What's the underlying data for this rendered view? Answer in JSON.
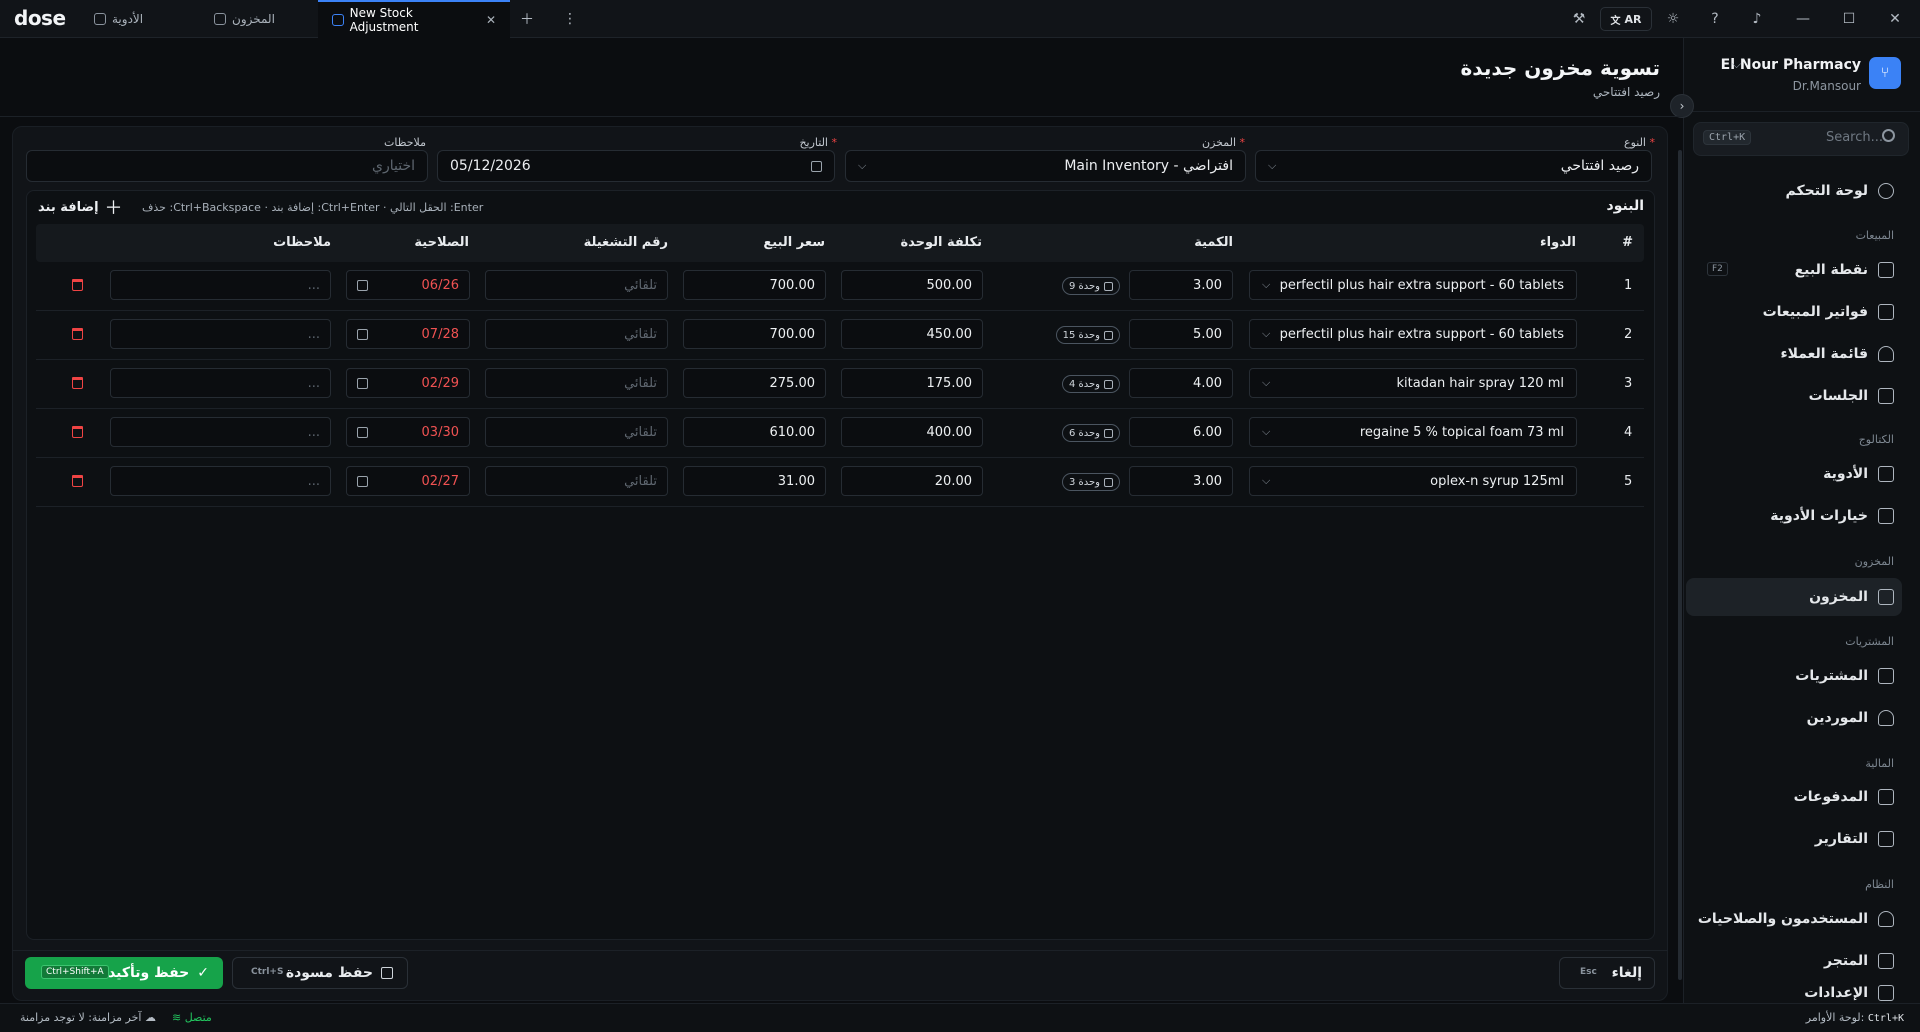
{
  "titlebar": {
    "logo": "dose",
    "tabs": [
      {
        "label": "الأدوية"
      },
      {
        "label": "المخزون"
      },
      {
        "label": "New Stock Adjustment"
      }
    ],
    "lang": "AR"
  },
  "sidebar": {
    "pharmacy_name": "El Nour Pharmacy",
    "user_name": "Dr.Mansour",
    "search_placeholder": "Search...",
    "search_shortcut": "Ctrl+K",
    "items": [
      {
        "label": "لوحة التحكم",
        "icon": "gauge-icon"
      },
      {
        "section": "المبيعات"
      },
      {
        "label": "نقطة البيع",
        "icon": "cart-icon",
        "shortcut": "F2"
      },
      {
        "label": "فواتير المبيعات",
        "icon": "invoice-icon"
      },
      {
        "label": "قائمة العملاء",
        "icon": "user-icon"
      },
      {
        "label": "الجلسات",
        "icon": "session-icon"
      },
      {
        "section": "الكتالوج"
      },
      {
        "label": "الأدوية",
        "icon": "pill-box-icon"
      },
      {
        "label": "خيارات الأدوية",
        "icon": "grid-icon"
      },
      {
        "section": "المخزون"
      },
      {
        "label": "المخزون",
        "icon": "inventory-icon",
        "active": true
      },
      {
        "section": "المشتريات"
      },
      {
        "label": "المشتريات",
        "icon": "purchases-icon"
      },
      {
        "label": "الموردين",
        "icon": "suppliers-icon"
      },
      {
        "section": "المالية"
      },
      {
        "label": "المدفوعات",
        "icon": "card-icon"
      },
      {
        "label": "التقارير",
        "icon": "chart-icon"
      },
      {
        "section": "النظام"
      },
      {
        "label": "المستخدمون والصلاحيات",
        "icon": "users-icon"
      },
      {
        "label": "المتجر",
        "icon": "store-icon"
      },
      {
        "label": "الإعدادات",
        "icon": "settings-icon"
      }
    ]
  },
  "header": {
    "title": "تسوية مخزون جديدة",
    "subtitle": "رصيد افتتاحي"
  },
  "form": {
    "type_label": "النوع",
    "type_value": "رصيد افتتاحي",
    "warehouse_label": "المخزن",
    "warehouse_value": "Main Inventory - افتراضي",
    "date_label": "التاريخ",
    "date_value": "05/12/2026",
    "notes_label": "ملاحظات",
    "notes_placeholder": "اختياري"
  },
  "items": {
    "title": "البنود",
    "hint": "Enter: الحقل التالي · Ctrl+Enter: إضافة بند · Ctrl+Backspace: حذف",
    "add_label": "إضافة بند",
    "columns": {
      "num": "#",
      "drug": "الدواء",
      "qty": "الكمية",
      "unit_cost": "تكلفة الوحدة",
      "sale_price": "سعر البيع",
      "batch": "رقم التشغيلة",
      "expiry": "الصلاحية",
      "notes": "ملاحظات"
    },
    "batch_placeholder": "تلقائي",
    "notes_placeholder": "...",
    "rows": [
      {
        "num": "1",
        "drug": "perfectil plus hair extra support - 60 tablets",
        "qty": "3.00",
        "units": "9 وحدة",
        "unit_cost": "500.00",
        "sale_price": "700.00",
        "expiry": "06/26"
      },
      {
        "num": "2",
        "drug": "perfectil plus hair extra support - 60 tablets",
        "qty": "5.00",
        "units": "15 وحدة",
        "unit_cost": "450.00",
        "sale_price": "700.00",
        "expiry": "07/28"
      },
      {
        "num": "3",
        "drug": "kitadan hair spray 120 ml",
        "qty": "4.00",
        "units": "4 وحدة",
        "unit_cost": "175.00",
        "sale_price": "275.00",
        "expiry": "02/29"
      },
      {
        "num": "4",
        "drug": "regaine 5 % topical foam 73 ml",
        "qty": "6.00",
        "units": "6 وحدة",
        "unit_cost": "400.00",
        "sale_price": "610.00",
        "expiry": "03/30"
      },
      {
        "num": "5",
        "drug": "oplex-n syrup 125ml",
        "qty": "3.00",
        "units": "3 وحدة",
        "unit_cost": "20.00",
        "sale_price": "31.00",
        "expiry": "02/27"
      }
    ]
  },
  "footer": {
    "save_confirm": "حفظ وتأكيد",
    "save_confirm_kbd": "Ctrl+Shift+A",
    "save_draft": "حفظ مسودة",
    "save_draft_kbd": "Ctrl+S",
    "cancel": "إلغاء",
    "cancel_kbd": "Esc"
  },
  "status": {
    "commands_label": "لوحة الأوامر:",
    "commands_kbd": "Ctrl+K",
    "connected": "متصل",
    "sync": "آخر مزامنة: لا توجد مزامنة"
  },
  "colors": {
    "accent": "#3b82f6",
    "success": "#16a34a",
    "danger": "#ef4444",
    "background": "#0b0d10"
  }
}
